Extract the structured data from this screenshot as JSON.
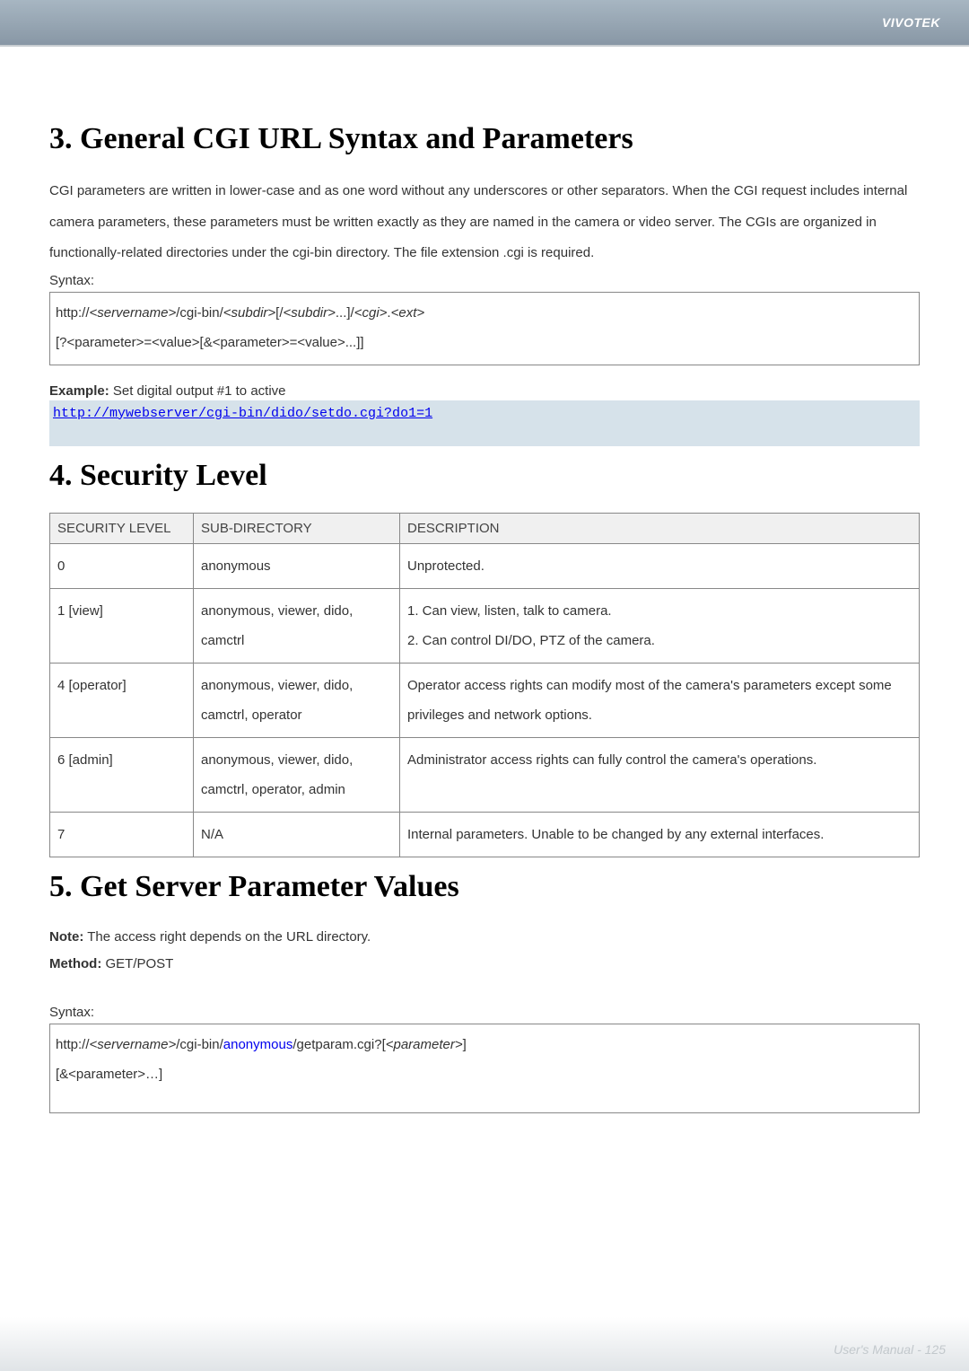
{
  "header": {
    "brand": "VIVOTEK"
  },
  "section3": {
    "title": "3. General CGI URL Syntax and Parameters",
    "body": "CGI parameters are written in lower-case and as one word without any underscores or other separators. When the CGI request includes internal camera parameters, these parameters must be written exactly as they are named in the camera or video server. The CGIs are organized in functionally-related directories under the cgi-bin directory. The file extension .cgi is required.",
    "syntax_label": "Syntax:",
    "syntax_line1_a": "http://",
    "syntax_line1_b": "<servername>",
    "syntax_line1_c": "/cgi-bin/",
    "syntax_line1_d": "<subdir>",
    "syntax_line1_e": "[/",
    "syntax_line1_f": "<subdir>",
    "syntax_line1_g": "...]/",
    "syntax_line1_h": "<cgi>",
    "syntax_line1_i": ".",
    "syntax_line1_j": "<ext>",
    "syntax_line2": "[?<parameter>=<value>[&<parameter>=<value>...]]",
    "example_bold": "Example:",
    "example_rest": " Set digital output #1 to active",
    "example_link": "http://mywebserver/cgi-bin/dido/setdo.cgi?do1=1"
  },
  "section4": {
    "title": "4. Security Level",
    "headers": {
      "a": "SECURITY LEVEL",
      "b": "SUB-DIRECTORY",
      "c": "DESCRIPTION"
    },
    "rows": [
      {
        "level": "0",
        "subdir": "anonymous",
        "desc": "Unprotected."
      },
      {
        "level": "1 [view]",
        "subdir": "anonymous, viewer, dido, camctrl",
        "desc": "1. Can view, listen, talk to camera.\n2. Can control DI/DO, PTZ of the camera."
      },
      {
        "level": "4 [operator]",
        "subdir": "anonymous, viewer, dido, camctrl, operator",
        "desc": "Operator access rights can modify most of the camera's parameters except some privileges and network options."
      },
      {
        "level": "6 [admin]",
        "subdir": "anonymous, viewer, dido, camctrl, operator, admin",
        "desc": "Administrator access rights can fully control the camera's operations."
      },
      {
        "level": "7",
        "subdir": "N/A",
        "desc": "Internal parameters. Unable to be changed by any external interfaces."
      }
    ]
  },
  "section5": {
    "title": "5. Get Server Parameter Values",
    "note_bold": "Note:",
    "note_rest": " The access right depends on the URL directory.",
    "method_bold": "Method:",
    "method_rest": " GET/POST",
    "syntax_label": "Syntax:",
    "box_line1_a": "http://",
    "box_line1_b": "<servername>",
    "box_line1_c": "/cgi-bin/",
    "box_line1_d": "anonymous",
    "box_line1_e": "/getparam.cgi?[",
    "box_line1_f": "<parameter>",
    "box_line1_g": "]",
    "box_line2": "[&<parameter>…]"
  },
  "footer": {
    "text": "User's Manual - 125"
  }
}
